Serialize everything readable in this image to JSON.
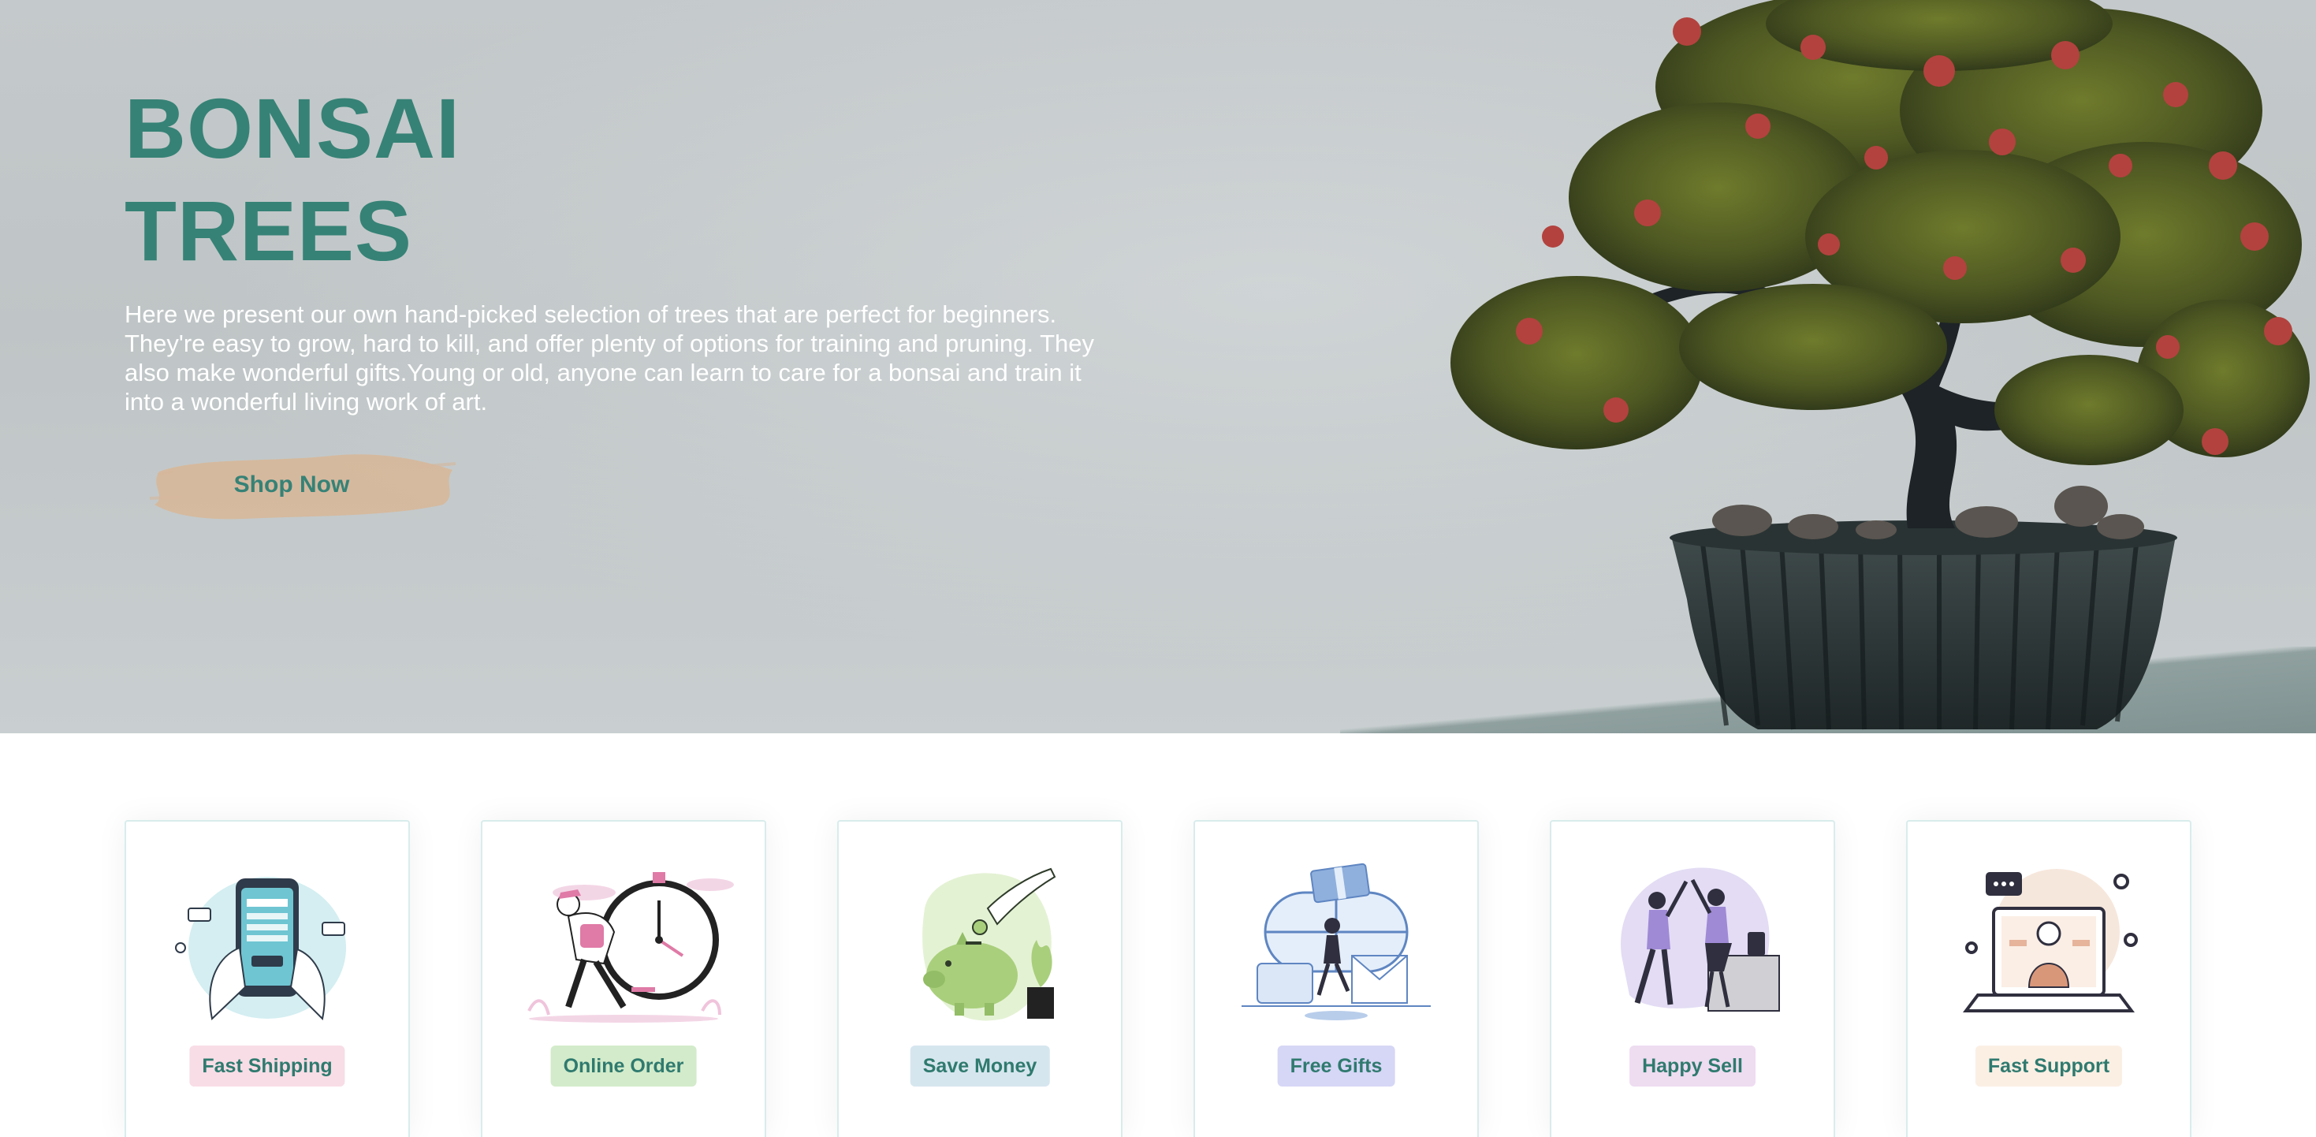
{
  "hero": {
    "title_line1": "BONSAI",
    "title_line2": "TREES",
    "description": "Here we present our own hand-picked selection of trees that are perfect for beginners. They're easy to grow, hard to kill, and offer plenty of options for training and pruning. They also make wonderful gifts.Young or old, anyone can learn to care for a bonsai and train it into a wonderful living work of art.",
    "cta_label": "Shop Now"
  },
  "features": [
    {
      "label": "Fast Shipping",
      "icon": "phone-payment-illustration",
      "tag_color": "#f8dde6"
    },
    {
      "label": "Online Order",
      "icon": "stopwatch-runner-illustration",
      "tag_color": "#d3ebca"
    },
    {
      "label": "Save Money",
      "icon": "piggy-bank-illustration",
      "tag_color": "#d6e6ef"
    },
    {
      "label": "Free Gifts",
      "icon": "gift-delivery-illustration",
      "tag_color": "#d6d6f6"
    },
    {
      "label": "Happy Sell",
      "icon": "high-five-illustration",
      "tag_color": "#eedcf1"
    },
    {
      "label": "Fast Support",
      "icon": "laptop-support-illustration",
      "tag_color": "#fbefe4"
    }
  ],
  "colors": {
    "brand_teal": "#368276",
    "button_brush": "#d6b89c",
    "hero_background": "#c4c9cb"
  }
}
